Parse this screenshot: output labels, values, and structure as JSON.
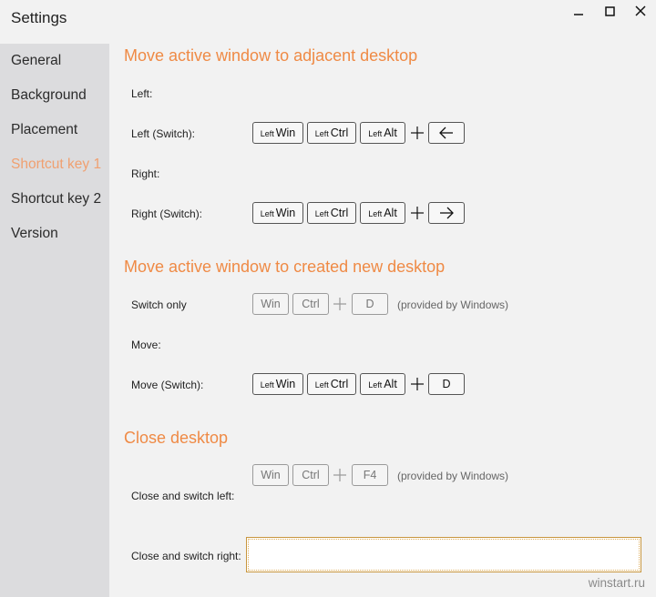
{
  "window": {
    "title": "Settings",
    "buttons": {
      "minimize": "minimize-icon",
      "maximize": "maximize-icon",
      "close": "close-icon"
    }
  },
  "sidebar": {
    "items": [
      {
        "label": "General",
        "active": false
      },
      {
        "label": "Background",
        "active": false
      },
      {
        "label": "Placement",
        "active": false
      },
      {
        "label": "Shortcut key 1",
        "active": true
      },
      {
        "label": "Shortcut key 2",
        "active": false
      },
      {
        "label": "Version",
        "active": false
      }
    ]
  },
  "sections": {
    "adjacent": {
      "title": "Move active window to adjacent desktop",
      "left_label": "Left:",
      "left_switch_label": "Left (Switch):",
      "right_label": "Right:",
      "right_switch_label": "Right (Switch):",
      "left_switch_keys": [
        "Win",
        "Ctrl",
        "Alt"
      ],
      "right_switch_keys": [
        "Win",
        "Ctrl",
        "Alt"
      ],
      "left_arrow_icon": "arrow-left-icon",
      "right_arrow_icon": "arrow-right-icon"
    },
    "new_desktop": {
      "title": "Move active window to created new desktop",
      "switch_only_label": "Switch only",
      "switch_only_keys": [
        "Win",
        "Ctrl",
        "D"
      ],
      "switch_only_note": "(provided by Windows)",
      "move_label": "Move:",
      "move_switch_label": "Move (Switch):",
      "move_switch_keys": [
        "Win",
        "Ctrl",
        "Alt",
        "D"
      ]
    },
    "close": {
      "title": "Close desktop",
      "keys": [
        "Win",
        "Ctrl",
        "F4"
      ],
      "note": "(provided by Windows)",
      "switch_left_label": "Close and switch left:",
      "switch_right_label": "Close and switch right:",
      "switch_right_value": ""
    }
  },
  "key_prefix": "Left",
  "watermark": "winstart.ru",
  "colors": {
    "accent": "#ef8a45",
    "active_nav": "#f0a070",
    "sidebar_bg": "#dcdcde",
    "page_bg": "#f2f2f2"
  }
}
